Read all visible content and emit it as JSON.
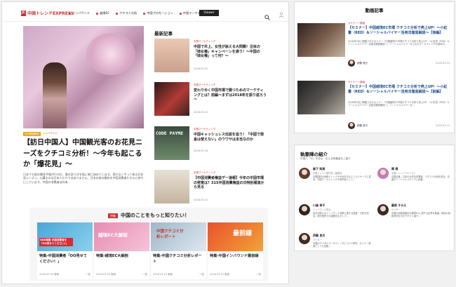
{
  "header": {
    "logo_badge": "JC",
    "logo_text": "中国トレンドEXPRESS",
    "nav": [
      "インバウンド",
      "越境EC",
      "クチコミ分析",
      "中国プロモーション",
      "中国マーケティング"
    ],
    "special_label": "Viewer",
    "search_icon": "search-icon",
    "login_icon": "user-icon"
  },
  "feature": {
    "tags": [
      "月次調査報告",
      "インバウンド"
    ],
    "title": "【訪日中国人】中国観光客のお花見ニーズをクチコミ分析！～今年も起こるか「爆花見」～",
    "excerpt": "日本でも桜の開花予報が行われ、春の訪づきを肌に感じ始めています。思わなくやって来るお花見シーズン。心躍るのは日本人だけではありません。日本の桜の開花を中国消費者たちも心待ちにしています。中国の消費者は外来..."
  },
  "recent": {
    "heading": "最新記事",
    "items": [
      {
        "tag": "中国マーケティング",
        "title": "中国で炎上、女性が訴える大問題！注目の「姉女権」キャンペーンを通う！～中国の「姉女権」って何？～",
        "date": "2018.03.20"
      },
      {
        "tag": "中国マーケティング",
        "title": "変わりゆく中国市場で勝つためのマーケティングとは？前編～まずは2018年を振り返ろう～",
        "date": "2018.03.19"
      },
      {
        "tag": "中国マーケティング",
        "title": "中国キャッシュレス伝説を追う！「中国で現金は使えない」のウワサは本当なのか",
        "date": "2018.03.16"
      },
      {
        "tag": "中国マーケティング",
        "title": "【中国消費者権益デー速報】今年の中国市場の発覚は？315中国消費権益の日特別報道から見る",
        "date": "2018.03.15"
      }
    ]
  },
  "promo": {
    "badge": "特集",
    "heading": "中国のことをもっと知りたい！",
    "cards": [
      {
        "img_text": "SNS特集 中国消費者を「OO見せてください!」",
        "title": "特集-中国消費者「OO見せてください！」",
        "date": "2018.03.20 更新",
        "more": "一覧"
      },
      {
        "img_text": "越境EC大解剖",
        "title": "特集-越境EC大解剖",
        "date": "2018.03.20 更新",
        "more": "一覧"
      },
      {
        "img_text": "中国クチコミ分析レポート",
        "title": "特集-中国クチコミ分析レポート",
        "date": "2018.03.19 更新",
        "more": "一覧"
      },
      {
        "img_text": "最前線",
        "title": "特集-中国インバウンド最前線",
        "date": "2018.03.19 更新",
        "more": "一覧"
      }
    ]
  },
  "videos": {
    "heading": "動画記事",
    "items": [
      {
        "tag": "セミナー / 動画",
        "title": "【セミナー】中国越境EC市場 クチコミ分析で売上UP！～小紅書（RED）&ソーシャルバイヤー活用法徹底解説～【後編】",
        "excerpt": "2018年3月に開催されたセミナー『中国越境EC市場クチコミ分析で売上UP！～小紅書（RED）&ソーシャルバイヤー活用法徹底解説～』ソーシャルバイヤーを入れたマーケティングの進め方...",
        "author": "伊藤 良方",
        "date": "2018.03.23"
      },
      {
        "tag": "セミナー / 動画",
        "title": "【セミナー】中国越境EC市場 クチコミ分析で売上UP！～小紅書（RED）&ソーシャルバイヤー活用法徹底解説～【前編】",
        "excerpt": "2018年3月に開催されたセミナー『中国越境EC市場クチコミ分析で売上UP！～小紅書（RED）&ソーシャルバイヤー活用法徹底解説～』ソーシャルバイヤーを...",
        "author": "伊藤 良方",
        "date": "2018.03.21"
      }
    ]
  },
  "writers": {
    "heading": "執筆陣の紹介",
    "subheading": "中国人「今」を知る・伝える執筆者をご紹介",
    "items": [
      {
        "name": "森下 知美",
        "role": "中国トレンド研究員 / 編集長",
        "desc": "中国国内の消費トレンドやSNSを中心としたリサーチに従事。中国マーケティングの専門家として..."
      },
      {
        "name": "陳 瑶",
        "role": "中国トレンドアナリスト",
        "desc": "中国出身。日本の大学を卒業後、クチコミ分析を担当。中国のソーシャルメディアに精通..."
      },
      {
        "name": "川島 幸子",
        "role": "インバウンド担当",
        "desc": "訪日中国人のインバウンド消費に関する調査・分析を担当。旅行業界での経験を生かして..."
      },
      {
        "name": "蘇航 すみえ",
        "role": "ライター",
        "desc": "中国の消費者動向や越境ECに関する記事を執筆。現地の最新事情を分かりやすく紹介..."
      },
      {
        "name": "伊藤 良方",
        "role": "ライター",
        "desc": "中国のデジタルマーケティングについて研究。セミナー講師としても活躍..."
      }
    ]
  }
}
